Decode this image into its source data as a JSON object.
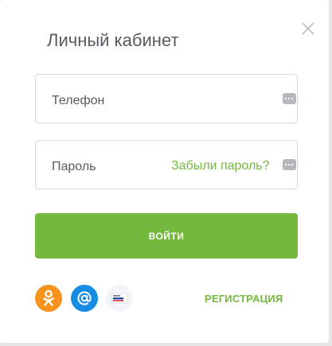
{
  "dialog": {
    "title": "Личный кабинет"
  },
  "fields": {
    "phone_placeholder": "Телефон",
    "password_placeholder": "Пароль",
    "forgot_link": "Забыли пароль?"
  },
  "actions": {
    "submit_label": "ВОЙТИ",
    "register_label": "РЕГИСТРАЦИЯ"
  },
  "social": [
    {
      "icon": "odnoklassniki-icon",
      "color": "#f7931e"
    },
    {
      "icon": "mail-ru-icon",
      "color": "#168de2"
    },
    {
      "icon": "gosuslugi-icon",
      "color": "#f3f5f8"
    }
  ],
  "colors": {
    "accent": "#74b83e",
    "text": "#555b63",
    "border": "#d4d7db"
  }
}
